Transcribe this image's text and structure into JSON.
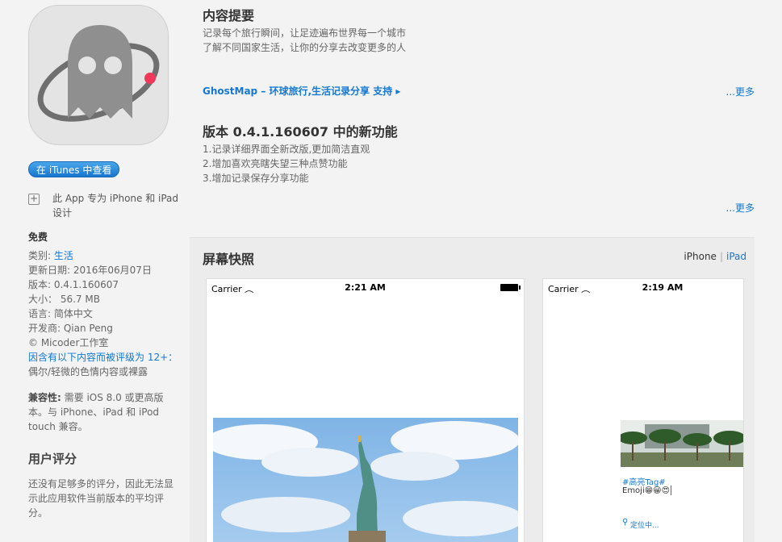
{
  "left": {
    "itunes_button": "在 iTunes 中查看",
    "ipad_note": "此 App 专为 iPhone 和 iPad 设计",
    "price": "免费",
    "info": {
      "category_label": "类别: ",
      "category_value": "生活",
      "updated": "更新日期: 2016年06月07日",
      "version": "版本: 0.4.1.160607",
      "size": "大小：  56.7 MB",
      "language": "语言: 简体中文",
      "developer": "开发商: Qian Peng",
      "copyright": "© Micoder工作室",
      "rating_link": "因含有以下内容而被评级为 12+：",
      "rating_detail": "偶尔/轻微的色情内容或裸露"
    },
    "compat_label": "兼容性:",
    "compat_text": " 需要 iOS 8.0 或更高版本。与 iPhone、iPad 和 iPod touch 兼容。",
    "rating_title": "用户评分",
    "rating_text": "还没有足够多的评分，因此无法显示此应用软件当前版本的平均评分。"
  },
  "main": {
    "desc_title": "内容提要",
    "desc_line1": "记录每个旅行瞬间，让足迹遍布世界每一个城市",
    "desc_line2": "了解不同国家生活，让你的分享去改变更多的人",
    "dev_link": "GhostMap – 环球旅行,生活记录分享 支持",
    "more1": "...更多",
    "whats_new_title": "版本 0.4.1.160607 中的新功能",
    "new1": "1.记录详细界面全新改版,更加简洁直观",
    "new2": "2.增加喜欢亮瞎失望三种点赞功能",
    "new3": "3.增加记录保存分享功能",
    "more2": "...更多"
  },
  "screenshots": {
    "title": "屏幕快照",
    "device_iphone": "iPhone",
    "device_ipad": "iPad",
    "phone1": {
      "carrier": "Carrier",
      "time": "2:21 AM"
    },
    "phone2": {
      "carrier": "Carrier",
      "time": "2:19 AM",
      "tag": "#高亮Tag#",
      "emoji_text": "Emoji😁😀😍",
      "locate": "定位中..."
    }
  }
}
